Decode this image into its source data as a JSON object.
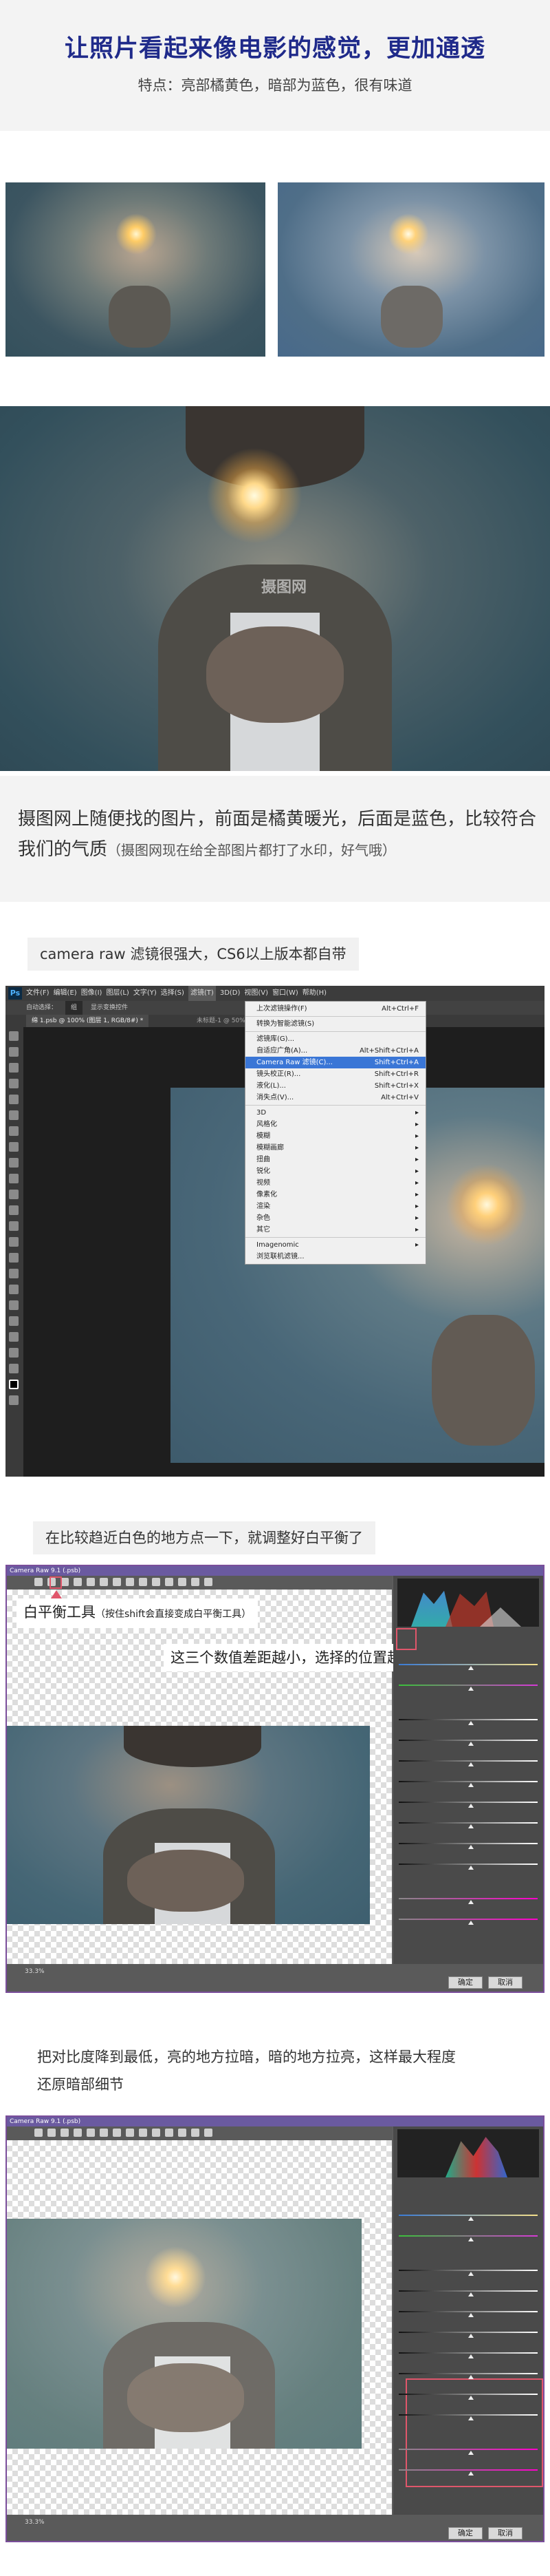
{
  "header": {
    "title": "让照片看起来像电影的感觉，更加通透",
    "subtitle": "特点：亮部橘黄色，暗部为蓝色，很有味道"
  },
  "photos": {
    "watermark": "摄图网"
  },
  "caption1": {
    "main": "摄图网上随便找的图片，前面是橘黄暖光，后面是蓝色，比较符合我们的气质",
    "note": "（摄图网现在给全部图片都打了水印，好气哦）"
  },
  "step1": {
    "label": "camera raw 滤镜很强大，CS6以上版本都自带"
  },
  "ps": {
    "logo": "Ps",
    "menubar": [
      "文件(F)",
      "编辑(E)",
      "图像(I)",
      "图层(L)",
      "文字(Y)",
      "选择(S)",
      "滤镜(T)",
      "3D(D)",
      "视图(V)",
      "窗口(W)",
      "帮助(H)"
    ],
    "options": [
      "自动选择：",
      "组",
      "显示变换控件"
    ],
    "doc_tab": "绵 1.psb @ 100% (图层 1, RGB/8#) *",
    "doc_tab2": "未标题-1 @ 50% (RGB/8) *",
    "filter_menu": {
      "items": [
        {
          "label": "上次滤镜操作(F)",
          "shortcut": "Alt+Ctrl+F"
        },
        {
          "label": "转换为智能滤镜(S)",
          "shortcut": ""
        },
        {
          "label": "滤镜库(G)...",
          "shortcut": ""
        },
        {
          "label": "自适应广角(A)...",
          "shortcut": "Alt+Shift+Ctrl+A"
        },
        {
          "label": "Camera Raw 滤镜(C)...",
          "shortcut": "Shift+Ctrl+A",
          "selected": true
        },
        {
          "label": "镜头校正(R)...",
          "shortcut": "Shift+Ctrl+R"
        },
        {
          "label": "液化(L)...",
          "shortcut": "Shift+Ctrl+X"
        },
        {
          "label": "消失点(V)...",
          "shortcut": "Alt+Ctrl+V"
        },
        {
          "label": "3D",
          "shortcut": ""
        },
        {
          "label": "风格化",
          "shortcut": ""
        },
        {
          "label": "模糊",
          "shortcut": ""
        },
        {
          "label": "模糊画廊",
          "shortcut": ""
        },
        {
          "label": "扭曲",
          "shortcut": ""
        },
        {
          "label": "锐化",
          "shortcut": ""
        },
        {
          "label": "视频",
          "shortcut": ""
        },
        {
          "label": "像素化",
          "shortcut": ""
        },
        {
          "label": "渲染",
          "shortcut": ""
        },
        {
          "label": "杂色",
          "shortcut": ""
        },
        {
          "label": "其它",
          "shortcut": ""
        },
        {
          "label": "Imagenomic",
          "shortcut": ""
        },
        {
          "label": "浏览联机滤镜...",
          "shortcut": ""
        }
      ]
    }
  },
  "step2": {
    "label": "在比较趋近白色的地方点一下，就调整好白平衡了",
    "window_title": "Camera Raw 9.1 (.psb)",
    "callout_tool": "白平衡工具",
    "callout_tool_note": "（按住shift会直接变成白平衡工具）",
    "callout_rgb": "这三个数值差距越小，选择的位置越趋近灰色",
    "zoom": "33.3%",
    "ok": "确定",
    "cancel": "取消"
  },
  "step3": {
    "label_line1": "把对比度降到最低，亮的地方拉暗，暗的地方拉亮，这样最大程度",
    "label_line2": "还原暗部细节",
    "window_title": "Camera Raw 9.1 (.psb)",
    "zoom": "33.3%",
    "ok": "确定",
    "cancel": "取消"
  },
  "colors": {
    "title_blue": "#1f2a8a",
    "ps_dark": "#2d2d2d",
    "menu_highlight": "#3a76d6",
    "cr_frame": "#7a4e9b",
    "highlight_box": "#e0566b"
  }
}
